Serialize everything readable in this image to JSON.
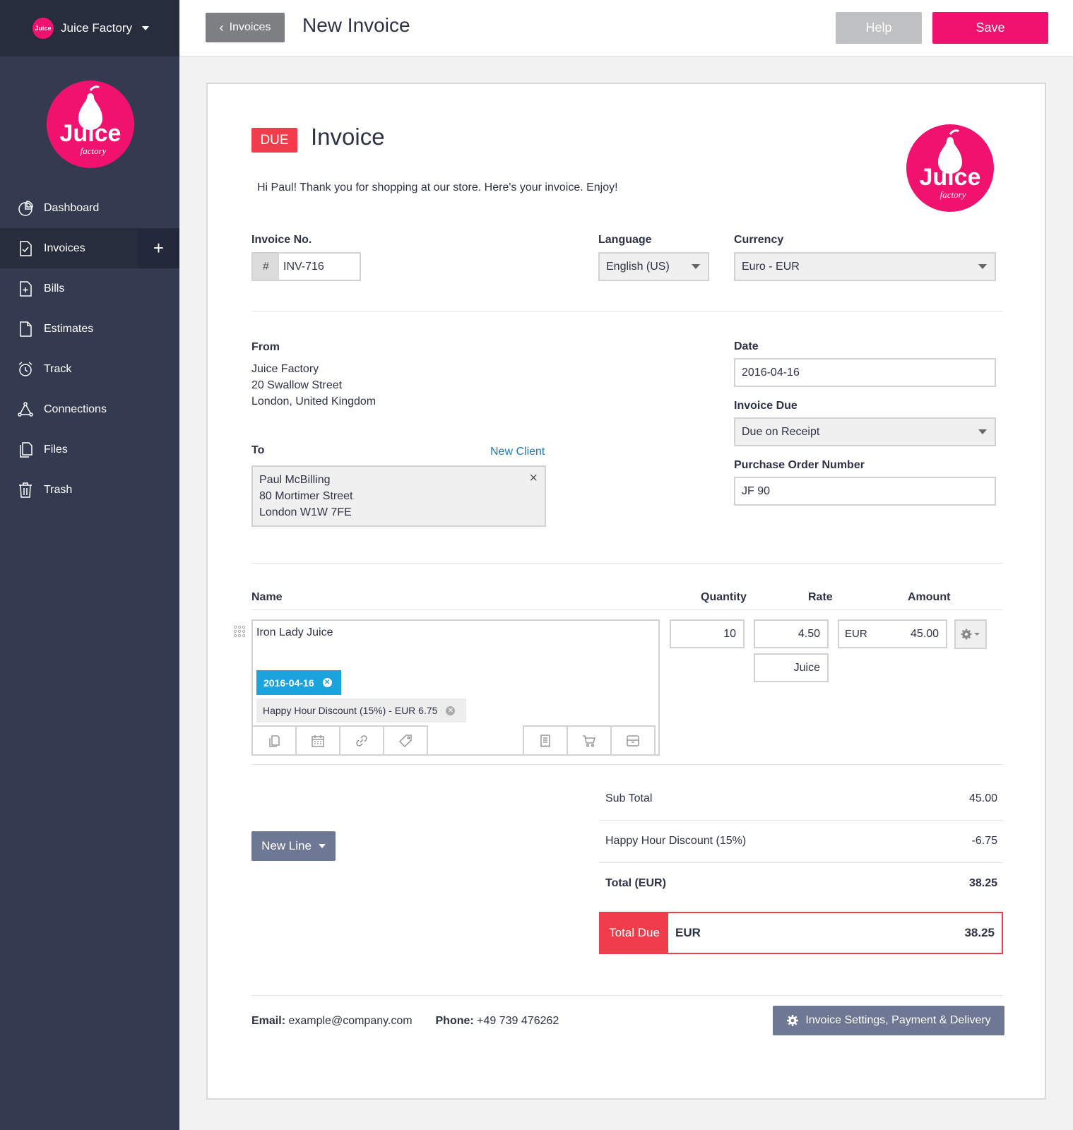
{
  "sidebar": {
    "company": "Juice Factory",
    "nav": [
      {
        "label": "Dashboard",
        "icon": "dashboard-icon"
      },
      {
        "label": "Invoices",
        "icon": "invoice-icon",
        "active": true
      },
      {
        "label": "Bills",
        "icon": "bill-icon"
      },
      {
        "label": "Estimates",
        "icon": "estimate-icon"
      },
      {
        "label": "Track",
        "icon": "alarm-clock-icon"
      },
      {
        "label": "Connections",
        "icon": "connections-icon"
      },
      {
        "label": "Files",
        "icon": "files-icon"
      },
      {
        "label": "Trash",
        "icon": "trash-icon"
      }
    ],
    "add_symbol": "+"
  },
  "logo": {
    "word": "Juice",
    "sub": "factory"
  },
  "header": {
    "back_label": "Invoices",
    "title": "New Invoice",
    "help_label": "Help",
    "save_label": "Save"
  },
  "invoice": {
    "status": "DUE",
    "title": "Invoice",
    "greeting": "Hi Paul! Thank you for shopping at our store. Here's your invoice. Enjoy!",
    "number_label": "Invoice No.",
    "number_prefix": "#",
    "number": "INV-716",
    "language_label": "Language",
    "language": "English (US)",
    "currency_label": "Currency",
    "currency": "Euro - EUR",
    "from_label": "From",
    "from": [
      "Juice Factory",
      "20 Swallow Street",
      "London, United Kingdom"
    ],
    "to_label": "To",
    "new_client_label": "New Client",
    "to": [
      "Paul McBilling",
      "80 Mortimer Street",
      "London W1W 7FE"
    ],
    "date_label": "Date",
    "date": "2016-04-16",
    "due_label": "Invoice Due",
    "due": "Due on Receipt",
    "po_label": "Purchase Order Number",
    "po": "JF 90"
  },
  "lines": {
    "headers": {
      "name": "Name",
      "quantity": "Quantity",
      "rate": "Rate",
      "amount": "Amount"
    },
    "items": [
      {
        "name": "Iron Lady Juice",
        "date_tag": "2016-04-16",
        "discount_tag": "Happy Hour Discount (15%) - EUR 6.75",
        "quantity": "10",
        "rate": "4.50",
        "unit": "Juice",
        "currency": "EUR",
        "amount": "45.00"
      }
    ],
    "new_line_label": "New Line"
  },
  "totals": {
    "subtotal_label": "Sub Total",
    "subtotal": "45.00",
    "discount_label": "Happy Hour Discount (15%)",
    "discount": "-6.75",
    "total_label": "Total (EUR)",
    "total": "38.25",
    "due_label": "Total Due",
    "due_currency": "EUR",
    "due_amount": "38.25"
  },
  "footer": {
    "email_label": "Email:",
    "email": "example@company.com",
    "phone_label": "Phone:",
    "phone": "+49 739 476262",
    "settings_label": "Invoice Settings, Payment & Delivery"
  },
  "colors": {
    "brand": "#f0126e",
    "due": "#f03c4b",
    "sidebar": "#343a4f",
    "link": "#1e7bc2",
    "tag": "#1aa3dd"
  }
}
